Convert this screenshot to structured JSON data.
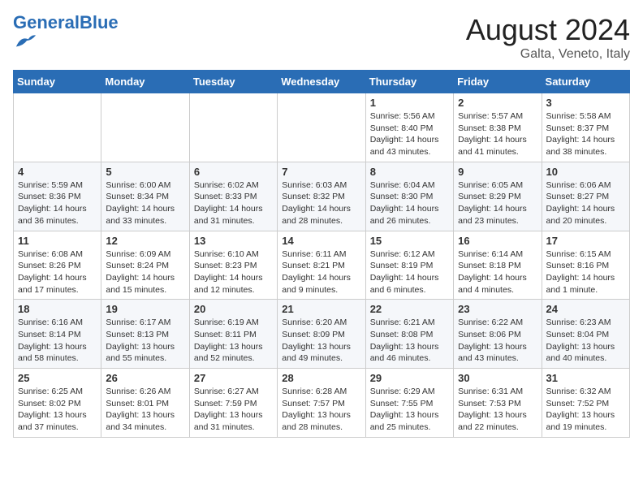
{
  "logo": {
    "text_general": "General",
    "text_blue": "Blue"
  },
  "title": "August 2024",
  "subtitle": "Galta, Veneto, Italy",
  "weekdays": [
    "Sunday",
    "Monday",
    "Tuesday",
    "Wednesday",
    "Thursday",
    "Friday",
    "Saturday"
  ],
  "weeks": [
    [
      {
        "day": "",
        "info": ""
      },
      {
        "day": "",
        "info": ""
      },
      {
        "day": "",
        "info": ""
      },
      {
        "day": "",
        "info": ""
      },
      {
        "day": "1",
        "info": "Sunrise: 5:56 AM\nSunset: 8:40 PM\nDaylight: 14 hours and 43 minutes."
      },
      {
        "day": "2",
        "info": "Sunrise: 5:57 AM\nSunset: 8:38 PM\nDaylight: 14 hours and 41 minutes."
      },
      {
        "day": "3",
        "info": "Sunrise: 5:58 AM\nSunset: 8:37 PM\nDaylight: 14 hours and 38 minutes."
      }
    ],
    [
      {
        "day": "4",
        "info": "Sunrise: 5:59 AM\nSunset: 8:36 PM\nDaylight: 14 hours and 36 minutes."
      },
      {
        "day": "5",
        "info": "Sunrise: 6:00 AM\nSunset: 8:34 PM\nDaylight: 14 hours and 33 minutes."
      },
      {
        "day": "6",
        "info": "Sunrise: 6:02 AM\nSunset: 8:33 PM\nDaylight: 14 hours and 31 minutes."
      },
      {
        "day": "7",
        "info": "Sunrise: 6:03 AM\nSunset: 8:32 PM\nDaylight: 14 hours and 28 minutes."
      },
      {
        "day": "8",
        "info": "Sunrise: 6:04 AM\nSunset: 8:30 PM\nDaylight: 14 hours and 26 minutes."
      },
      {
        "day": "9",
        "info": "Sunrise: 6:05 AM\nSunset: 8:29 PM\nDaylight: 14 hours and 23 minutes."
      },
      {
        "day": "10",
        "info": "Sunrise: 6:06 AM\nSunset: 8:27 PM\nDaylight: 14 hours and 20 minutes."
      }
    ],
    [
      {
        "day": "11",
        "info": "Sunrise: 6:08 AM\nSunset: 8:26 PM\nDaylight: 14 hours and 17 minutes."
      },
      {
        "day": "12",
        "info": "Sunrise: 6:09 AM\nSunset: 8:24 PM\nDaylight: 14 hours and 15 minutes."
      },
      {
        "day": "13",
        "info": "Sunrise: 6:10 AM\nSunset: 8:23 PM\nDaylight: 14 hours and 12 minutes."
      },
      {
        "day": "14",
        "info": "Sunrise: 6:11 AM\nSunset: 8:21 PM\nDaylight: 14 hours and 9 minutes."
      },
      {
        "day": "15",
        "info": "Sunrise: 6:12 AM\nSunset: 8:19 PM\nDaylight: 14 hours and 6 minutes."
      },
      {
        "day": "16",
        "info": "Sunrise: 6:14 AM\nSunset: 8:18 PM\nDaylight: 14 hours and 4 minutes."
      },
      {
        "day": "17",
        "info": "Sunrise: 6:15 AM\nSunset: 8:16 PM\nDaylight: 14 hours and 1 minute."
      }
    ],
    [
      {
        "day": "18",
        "info": "Sunrise: 6:16 AM\nSunset: 8:14 PM\nDaylight: 13 hours and 58 minutes."
      },
      {
        "day": "19",
        "info": "Sunrise: 6:17 AM\nSunset: 8:13 PM\nDaylight: 13 hours and 55 minutes."
      },
      {
        "day": "20",
        "info": "Sunrise: 6:19 AM\nSunset: 8:11 PM\nDaylight: 13 hours and 52 minutes."
      },
      {
        "day": "21",
        "info": "Sunrise: 6:20 AM\nSunset: 8:09 PM\nDaylight: 13 hours and 49 minutes."
      },
      {
        "day": "22",
        "info": "Sunrise: 6:21 AM\nSunset: 8:08 PM\nDaylight: 13 hours and 46 minutes."
      },
      {
        "day": "23",
        "info": "Sunrise: 6:22 AM\nSunset: 8:06 PM\nDaylight: 13 hours and 43 minutes."
      },
      {
        "day": "24",
        "info": "Sunrise: 6:23 AM\nSunset: 8:04 PM\nDaylight: 13 hours and 40 minutes."
      }
    ],
    [
      {
        "day": "25",
        "info": "Sunrise: 6:25 AM\nSunset: 8:02 PM\nDaylight: 13 hours and 37 minutes."
      },
      {
        "day": "26",
        "info": "Sunrise: 6:26 AM\nSunset: 8:01 PM\nDaylight: 13 hours and 34 minutes."
      },
      {
        "day": "27",
        "info": "Sunrise: 6:27 AM\nSunset: 7:59 PM\nDaylight: 13 hours and 31 minutes."
      },
      {
        "day": "28",
        "info": "Sunrise: 6:28 AM\nSunset: 7:57 PM\nDaylight: 13 hours and 28 minutes."
      },
      {
        "day": "29",
        "info": "Sunrise: 6:29 AM\nSunset: 7:55 PM\nDaylight: 13 hours and 25 minutes."
      },
      {
        "day": "30",
        "info": "Sunrise: 6:31 AM\nSunset: 7:53 PM\nDaylight: 13 hours and 22 minutes."
      },
      {
        "day": "31",
        "info": "Sunrise: 6:32 AM\nSunset: 7:52 PM\nDaylight: 13 hours and 19 minutes."
      }
    ]
  ]
}
